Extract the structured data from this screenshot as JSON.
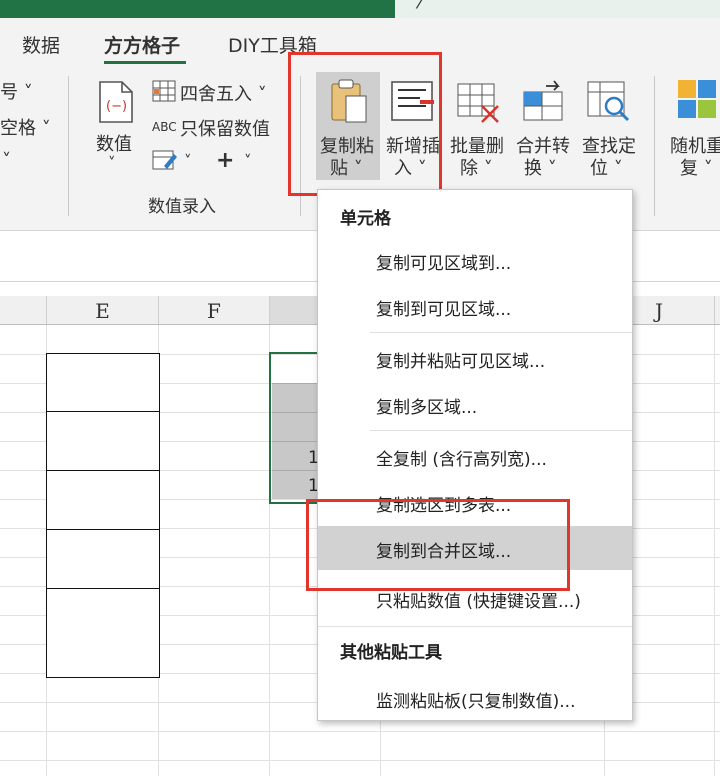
{
  "tabs": [
    {
      "label": "数据",
      "active": false
    },
    {
      "label": "方方格子",
      "active": true
    },
    {
      "label": "DIY工具箱",
      "active": false
    }
  ],
  "ribbon": {
    "left_partial": {
      "item1": "号 ˅",
      "item2": "空格 ˅",
      "item3": "˅"
    },
    "numeric_group": {
      "value_button": "数值",
      "round_button": "四舍五入 ˅",
      "keep_value_button": "只保留数值",
      "mini_chevron": "˅",
      "plus_label": "+",
      "group_label": "数值录入"
    },
    "buttons": [
      {
        "label1": "复制粘",
        "label2": "贴 ˅"
      },
      {
        "label1": "新增插",
        "label2": "入 ˅"
      },
      {
        "label1": "批量删",
        "label2": "除 ˅"
      },
      {
        "label1": "合并转",
        "label2": "换 ˅"
      },
      {
        "label1": "查找定",
        "label2": "位 ˅"
      },
      {
        "label1": "随机重",
        "label2": "复 ˅"
      }
    ],
    "abc_label": "ABC"
  },
  "sheet": {
    "columns": [
      "E",
      "F",
      "J"
    ],
    "visible_digits": [
      "1",
      "1"
    ]
  },
  "menu": {
    "section1": "单元格",
    "items1": [
      "复制可见区域到...",
      "复制到可见区域...",
      "复制并粘贴可见区域...",
      "复制多区域...",
      "全复制 (含行高列宽)...",
      "复制选区到多表...",
      "复制到合并区域...",
      "只粘贴数值 (快捷键设置...)"
    ],
    "highlighted_index": 6,
    "section2": "其他粘贴工具",
    "items2": [
      "监测粘贴板(只复制数值)..."
    ]
  },
  "colors": {
    "accent": "#217346",
    "highlight": "#e0362c",
    "menu_hover": "#d2d2d2"
  }
}
